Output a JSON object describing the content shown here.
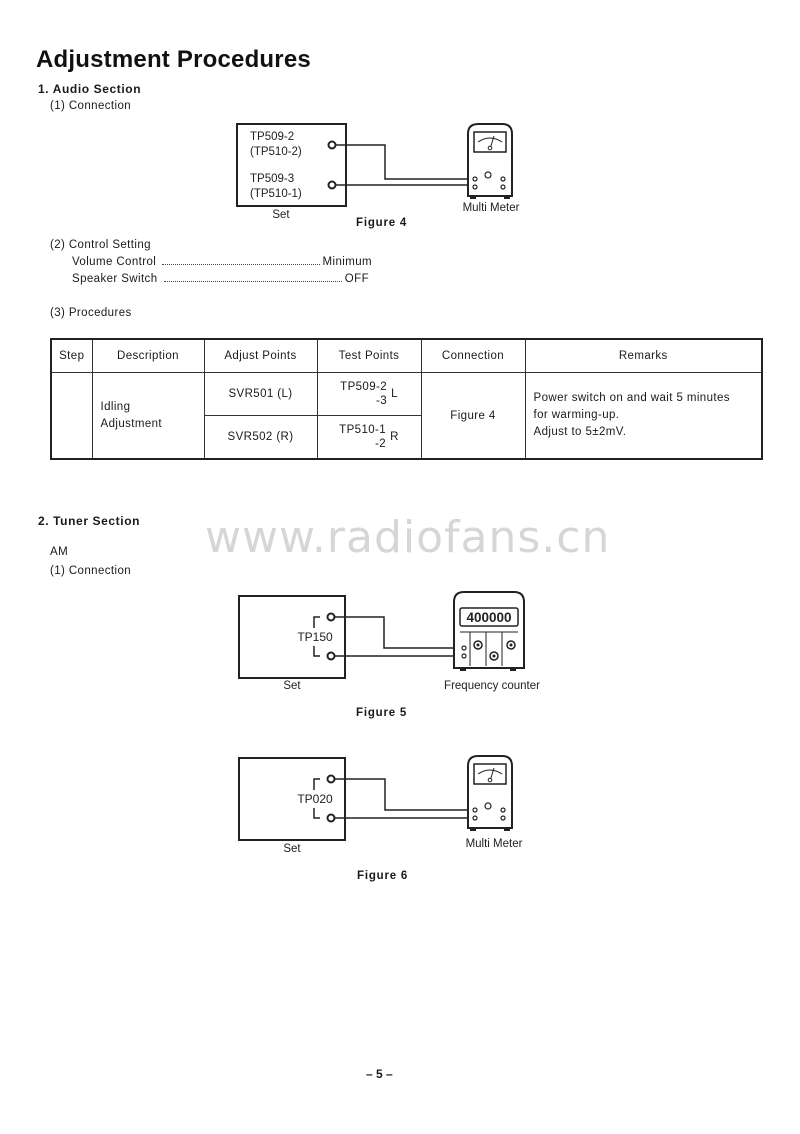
{
  "page_title": "Adjustment Procedures",
  "watermark": "www.radiofans.cn",
  "audio_section": {
    "heading": "1.  Audio  Section",
    "connection_heading": "(1) Connection",
    "figure": {
      "set_tp_top": "TP509-2",
      "set_tp_top_alt": "(TP510-2)",
      "set_tp_bottom": "TP509-3",
      "set_tp_bottom_alt": "(TP510-1)",
      "set_label": "Set",
      "instrument_label": "Multi  Meter",
      "caption": "Figure  4"
    },
    "control_setting": {
      "heading": "(2) Control  Setting",
      "items": [
        {
          "label": "Volume  Control",
          "value": "Minimum"
        },
        {
          "label": "Speaker  Switch",
          "value": "OFF"
        }
      ]
    },
    "procedures": {
      "heading": "(3) Procedures",
      "headers": [
        "Step",
        "Description",
        "Adjust  Points",
        "Test  Points",
        "Connection",
        "Remarks"
      ],
      "rows": [
        {
          "step": "",
          "description_line1": "Idling",
          "description_line2": "Adjustment",
          "adjust_l": "SVR501  (L)",
          "adjust_r": "SVR502  (R)",
          "test_l_top": "TP509-2",
          "test_l_bottom": "-3",
          "test_l_ch": "L",
          "test_r_top": "TP510-1",
          "test_r_bottom": "-2",
          "test_r_ch": "R",
          "connection": "Figure  4",
          "remarks_line1": "Power  switch  on  and  wait  5  minutes",
          "remarks_line2": "for  warming-up.",
          "remarks_line3": "Adjust  to  5±2mV."
        }
      ]
    }
  },
  "tuner_section": {
    "heading": "2.  Tuner  Section",
    "band": "AM",
    "connection_heading": "(1) Connection",
    "figure5": {
      "tp_label": "TP150",
      "set_label": "Set",
      "display_value": "400000",
      "instrument_label": "Frequency  counter",
      "caption": "Figure  5"
    },
    "figure6": {
      "tp_label": "TP020",
      "set_label": "Set",
      "instrument_label": "Multi  Meter",
      "caption": "Figure  6"
    }
  },
  "page_number": "– 5 –"
}
